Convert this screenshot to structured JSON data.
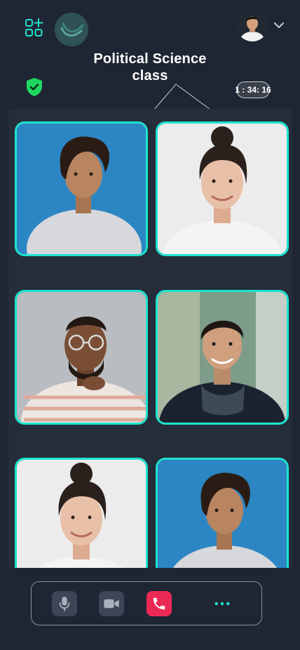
{
  "header": {
    "title": "Political  Science class",
    "timer": "1 : 34: 16"
  },
  "icons": {
    "apps": "apps-plus-icon",
    "logo": "brand-logo",
    "security": "shield-check-icon",
    "dropdown": "chevron-down-icon",
    "mic": "microphone-icon",
    "camera": "video-camera-icon",
    "end_call": "phone-icon",
    "more": "more-dots-icon"
  },
  "colors": {
    "background": "#1f2633",
    "panel": "#252d3a",
    "accent": "#1ee3cf",
    "end_call": "#ea2a55",
    "security": "#1ed760"
  },
  "participants": [
    {
      "id": "p1",
      "background": "#2d86c4",
      "skin": "#b88560",
      "hair": "#2a1c14",
      "shirt": "#d6d8dc"
    },
    {
      "id": "p2",
      "background": "#ececec",
      "skin": "#e8c0a7",
      "hair": "#2b211c",
      "shirt": "#f4f4f4"
    },
    {
      "id": "p3",
      "background": "#b9bcc0",
      "skin": "#7a4e35",
      "hair": "#231812",
      "shirt": "#ece5e0"
    },
    {
      "id": "p4",
      "background": "#7d9c8a",
      "skin": "#d09f7d",
      "hair": "#1f1714",
      "shirt": "#1b2230"
    },
    {
      "id": "p5",
      "background": "#ececec",
      "skin": "#e8c0a7",
      "hair": "#2b211c",
      "shirt": "#f4f4f4"
    },
    {
      "id": "p6",
      "background": "#2d86c4",
      "skin": "#b88560",
      "hair": "#2a1c14",
      "shirt": "#d6d8dc"
    }
  ]
}
